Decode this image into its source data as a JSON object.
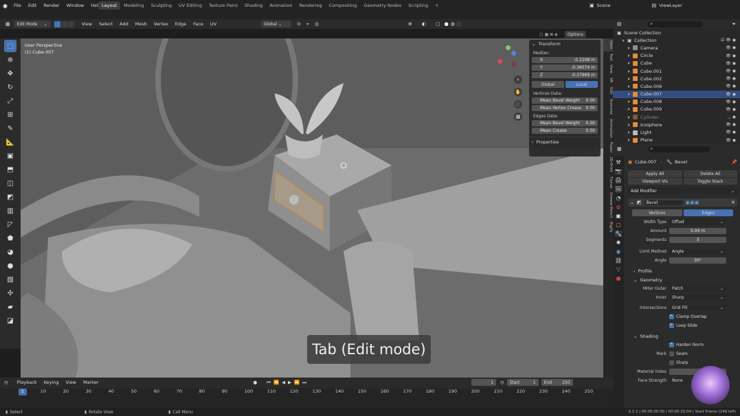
{
  "topbar": {
    "menus": [
      "File",
      "Edit",
      "Render",
      "Window",
      "Help"
    ],
    "workspaces": [
      "Layout",
      "Modeling",
      "Sculpting",
      "UV Editing",
      "Texture Paint",
      "Shading",
      "Animation",
      "Rendering",
      "Compositing",
      "Geometry Nodes",
      "Scripting"
    ],
    "active_workspace": "Layout",
    "scene": "Scene",
    "view_layer": "ViewLayer"
  },
  "header": {
    "mode": "Edit Mode",
    "menus": [
      "View",
      "Select",
      "Add",
      "Mesh",
      "Vertex",
      "Edge",
      "Face",
      "UV"
    ],
    "orientation": "Global",
    "options": "Options"
  },
  "viewport": {
    "perspective": "User Perspective",
    "object": "(1) Cube.007",
    "overlay_caption": "Tab (Edit mode)"
  },
  "npanel": {
    "transform": "Transform",
    "median": "Median:",
    "x_label": "X",
    "x": "-0.2208 m",
    "y_label": "Y",
    "y": "-0.36074 m",
    "z_label": "Z",
    "z": "-0.37969 m",
    "global": "Global",
    "local": "Local",
    "vertices_data": "Vertices Data:",
    "mean_bevel_weight": "Mean Bevel Weight",
    "mbw_v": "0.00",
    "mean_vertex_crease": "Mean Vertex Crease",
    "mvc_v": "0.00",
    "edges_data": "Edges Data:",
    "mean_bevel_weight_e": "Mean Bevel Weight",
    "mbw_e": "0.00",
    "mean_crease": "Mean Crease",
    "mc_e": "0.00",
    "properties": "Properties"
  },
  "ntabs": [
    "Item",
    "Tool",
    "View",
    "VR",
    "Edit",
    "Animate",
    "Animation",
    "Paper",
    "3D-Print",
    "Tissue",
    "Grease Pencil",
    "Rigify"
  ],
  "outliner": {
    "scene_collection": "Scene Collection",
    "collection": "Collection",
    "items": [
      "Camera",
      "Circle",
      "Cube",
      "Cube.001",
      "Cube.002",
      "Cube.006",
      "Cube.007",
      "Cube.008",
      "Cube.009",
      "Cylinder",
      "Icosphere",
      "Light",
      "Plane"
    ],
    "selected": "Cube.007"
  },
  "properties": {
    "object": "Cube.007",
    "modifier": "Bevel",
    "apply_all": "Apply All",
    "delete_all": "Delete All",
    "viewport_vis": "Viewport Vis",
    "toggle_stack": "Toggle Stack",
    "add_modifier": "Add Modifier",
    "mod_name": "Bevel",
    "vertices": "Vertices",
    "edges": "Edges",
    "width_type_l": "Width Type",
    "width_type": "Offset",
    "amount_l": "Amount",
    "amount": "0.04 m",
    "segments_l": "Segments",
    "segments": "3",
    "limit_method_l": "Limit Method",
    "limit_method": "Angle",
    "angle_l": "Angle",
    "angle": "30°",
    "profile": "Profile",
    "geometry": "Geometry",
    "miter_outer_l": "Miter Outer",
    "miter_outer": "Patch",
    "inner_l": "Inner",
    "inner": "Sharp",
    "intersections_l": "Intersections",
    "intersections": "Grid Fill",
    "clamp_overlap": "Clamp Overlap",
    "loop_slide": "Loop Slide",
    "shading": "Shading",
    "harden_normals": "Harden Norm",
    "mark_l": "Mark",
    "seam": "Seam",
    "sharp": "Sharp",
    "material_index_l": "Material Index",
    "face_strength_l": "Face Strength",
    "face_strength": "None"
  },
  "timeline": {
    "menus": [
      "Playback",
      "Keying",
      "View",
      "Marker"
    ],
    "current_frame": "1",
    "start_l": "Start",
    "start": "1",
    "end_l": "End",
    "end": "250",
    "ticks": [
      "1",
      "10",
      "20",
      "30",
      "40",
      "50",
      "60",
      "70",
      "80",
      "90",
      "100",
      "110",
      "120",
      "130",
      "140",
      "150",
      "160",
      "170",
      "180",
      "190",
      "200",
      "210",
      "220",
      "230",
      "240",
      "250"
    ]
  },
  "status": {
    "select": "Select",
    "rotate": "Rotate View",
    "call_menu": "Call Menu",
    "info": "3.2.2 | 00:00:00:00 / 00:00:10:09 | Start Frame (249 left)"
  }
}
